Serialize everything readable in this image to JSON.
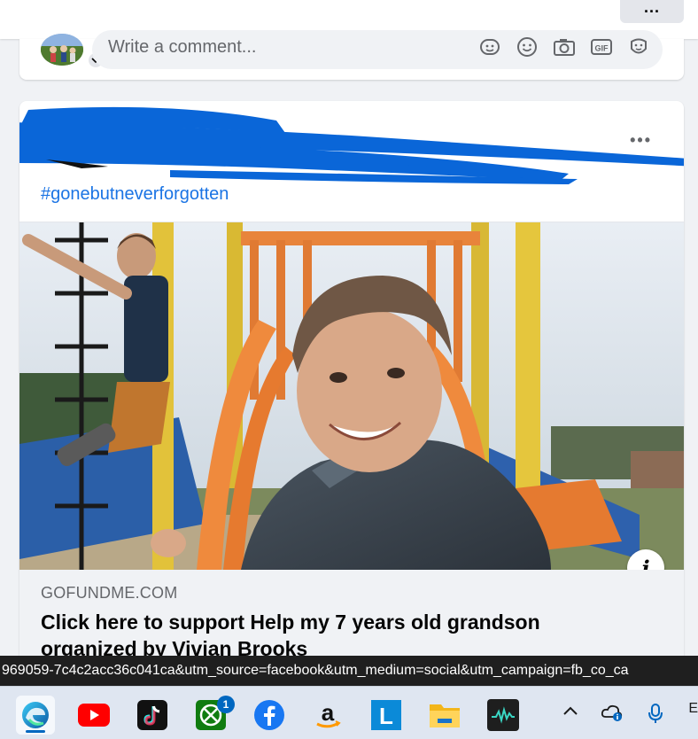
{
  "top_bar": {
    "more_label": "..."
  },
  "comment_bar": {
    "placeholder": "Write a comment...",
    "icons": [
      "sticker-icon",
      "emoji-icon",
      "camera-icon",
      "gif-icon",
      "avatar-sticker-icon"
    ],
    "gif_label": "GIF"
  },
  "post": {
    "more_label": "•••",
    "hashtag": "#gonebutneverforgotten",
    "info_label": "i",
    "link": {
      "domain": "GOFUNDME.COM",
      "title_line1": "Click here to support Help my 7 years old grandson",
      "title_line2": "organized by Vivian Brooks"
    }
  },
  "status_bar": {
    "url": "969059-7c4c2acc36c041ca&utm_source=facebook&utm_medium=social&utm_campaign=fb_co_ca"
  },
  "taskbar": {
    "apps": [
      {
        "name": "edge-icon",
        "active": true
      },
      {
        "name": "youtube-icon"
      },
      {
        "name": "tiktok-icon"
      },
      {
        "name": "xbox-icon",
        "badge": "1"
      },
      {
        "name": "facebook-icon"
      },
      {
        "name": "amazon-icon"
      },
      {
        "name": "l-app-icon",
        "label": "L"
      },
      {
        "name": "file-explorer-icon"
      },
      {
        "name": "audio-app-icon"
      }
    ],
    "xbox_badge": "1",
    "l_label": "L",
    "tray_edge": "E"
  },
  "colors": {
    "link_blue": "#1b74e4",
    "redaction_blue": "#0a66d8",
    "taskbar_bg": "#dfe6f1"
  }
}
